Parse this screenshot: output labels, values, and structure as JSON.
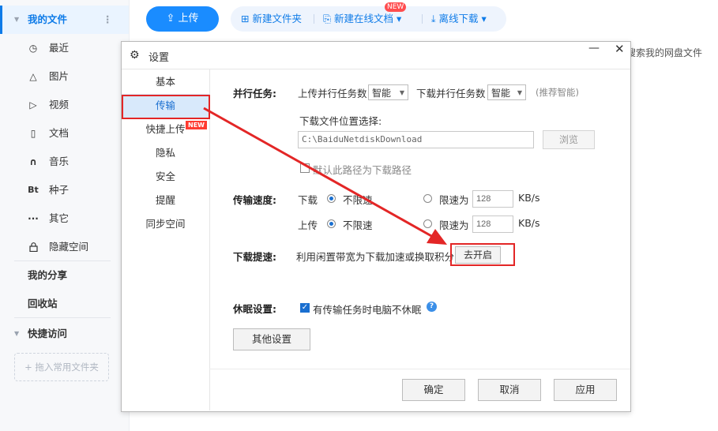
{
  "sidebar": {
    "my_files": "我的文件",
    "items": [
      {
        "icon": "clock-icon",
        "glyph": "◷",
        "label": "最近"
      },
      {
        "icon": "image-icon",
        "glyph": "△",
        "label": "图片"
      },
      {
        "icon": "video-icon",
        "glyph": "▷",
        "label": "视频"
      },
      {
        "icon": "document-icon",
        "glyph": "▯",
        "label": "文档"
      },
      {
        "icon": "headphones-icon",
        "glyph": "∩",
        "label": "音乐"
      },
      {
        "icon": "bt-icon",
        "glyph": "Bt",
        "label": "种子"
      },
      {
        "icon": "more-icon",
        "glyph": "···",
        "label": "其它"
      },
      {
        "icon": "lock-icon",
        "glyph": "🔒︎",
        "label": "隐藏空间"
      }
    ],
    "my_share": "我的分享",
    "recycle_bin": "回收站",
    "quick_access": "快捷访问",
    "drag_hint": "拖入常用文件夹"
  },
  "toolbar": {
    "upload": "上传",
    "new_folder": "新建文件夹",
    "new_online_doc": "新建在线文档",
    "new_badge": "NEW",
    "offline_download": "离线下载"
  },
  "search_hint": "搜索我的网盘文件",
  "dialog": {
    "title": "设置",
    "nav": [
      "基本",
      "传输",
      "快捷上传",
      "隐私",
      "安全",
      "提醒",
      "同步空间"
    ],
    "nav_new_badge": "NEW",
    "selected_nav": "传输",
    "parallel": {
      "label": "并行任务:",
      "upload_label": "上传并行任务数",
      "upload_value": "智能",
      "download_label": "下载并行任务数",
      "download_value": "智能",
      "hint": "(推荐智能)"
    },
    "download_location": {
      "label": "下载文件位置选择:",
      "path": "C:\\BaiduNetdiskDownload",
      "browse": "浏览",
      "default_checkbox": "默认此路径为下载路径"
    },
    "speed": {
      "label": "传输速度:",
      "download_label": "下载",
      "upload_label": "上传",
      "unlimited": "不限速",
      "limit_to": "限速为",
      "download_limit_value": "128",
      "upload_limit_value": "128",
      "unit": "KB/s"
    },
    "boost": {
      "label": "下载提速:",
      "text": "利用闲置带宽为下载加速或换取积分",
      "button": "去开启"
    },
    "sleep": {
      "label": "休眠设置:",
      "checkbox": "有传输任务时电脑不休眠",
      "checked": true
    },
    "other_settings": "其他设置",
    "ok": "确定",
    "cancel": "取消",
    "apply": "应用"
  },
  "colors": {
    "accent": "#1a8cff",
    "annotation_red": "#e32626",
    "selected_nav_bg": "#d8e9fb"
  }
}
